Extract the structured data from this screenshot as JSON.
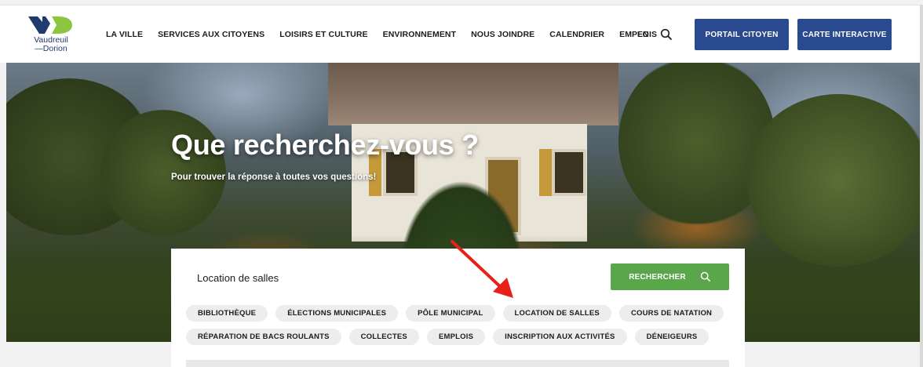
{
  "brand": {
    "logo_text": "Vaudreuil\n—Dorion",
    "colors": {
      "navy": "#2a4a8f",
      "green": "#5aa64a",
      "logo_blue": "#1f3b6e",
      "logo_green": "#8cc63f"
    }
  },
  "nav": {
    "items": [
      {
        "label": "LA VILLE"
      },
      {
        "label": "SERVICES AUX CITOYENS"
      },
      {
        "label": "LOISIRS ET CULTURE"
      },
      {
        "label": "ENVIRONNEMENT"
      },
      {
        "label": "NOUS JOINDRE"
      },
      {
        "label": "CALENDRIER"
      },
      {
        "label": "EMPLOIS"
      }
    ],
    "lang": "EN",
    "search_icon": "search-icon",
    "portail_label": "PORTAIL CITOYEN",
    "carte_label": "CARTE INTERACTIVE"
  },
  "hero": {
    "title": "Que recherchez-vous ?",
    "subtitle": "Pour trouver la réponse à toutes vos questions!"
  },
  "search": {
    "value": "Location de salles",
    "button_label": "RECHERCHER",
    "button_icon": "search-icon",
    "chips_row1": [
      "BIBLIOTHÈQUE",
      "ÉLECTIONS MUNICIPALES",
      "PÔLE MUNICIPAL",
      "LOCATION DE SALLES",
      "COURS DE NATATION"
    ],
    "chips_row2": [
      "RÉPARATION DE BACS ROULANTS",
      "COLLECTES",
      "EMPLOIS",
      "INSCRIPTION AUX ACTIVITÉS",
      "DÉNEIGEURS"
    ]
  },
  "annotation": {
    "arrow_color": "#e8201a"
  }
}
